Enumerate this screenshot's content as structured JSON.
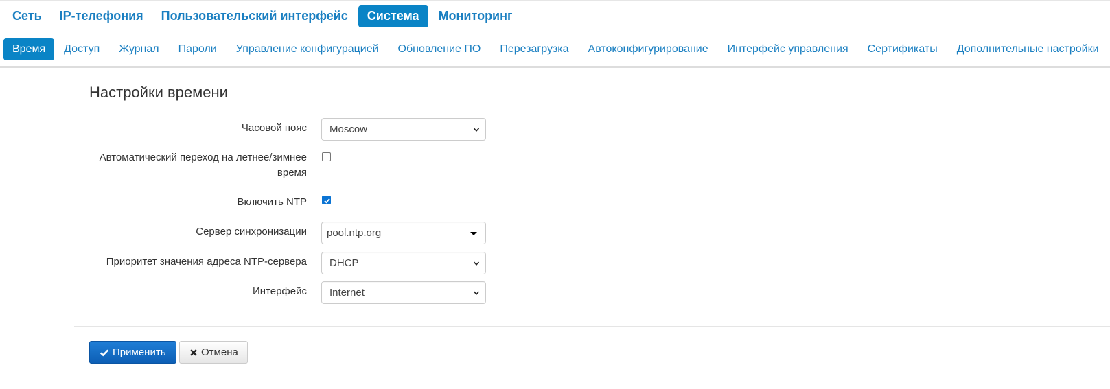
{
  "topnav": {
    "items": [
      {
        "label": "Сеть"
      },
      {
        "label": "IP-телефония"
      },
      {
        "label": "Пользовательский интерфейс"
      },
      {
        "label": "Система"
      },
      {
        "label": "Мониторинг"
      }
    ],
    "active": "Система"
  },
  "subnav": {
    "items": [
      {
        "label": "Время"
      },
      {
        "label": "Доступ"
      },
      {
        "label": "Журнал"
      },
      {
        "label": "Пароли"
      },
      {
        "label": "Управление конфигурацией"
      },
      {
        "label": "Обновление ПО"
      },
      {
        "label": "Перезагрузка"
      },
      {
        "label": "Автоконфигурирование"
      },
      {
        "label": "Интерфейс управления"
      },
      {
        "label": "Сертификаты"
      },
      {
        "label": "Дополнительные настройки"
      }
    ],
    "active": "Время"
  },
  "section": {
    "title": "Настройки времени"
  },
  "form": {
    "timezone": {
      "label": "Часовой пояс",
      "value": "Moscow"
    },
    "dst": {
      "label_line1": "Автоматический переход на летнее/зимнее",
      "label_line2": "время",
      "checked": false
    },
    "ntp": {
      "label": "Включить NTP",
      "checked": true
    },
    "sync_server": {
      "label": "Сервер синхронизации",
      "value": "pool.ntp.org"
    },
    "ntp_priority": {
      "label": "Приоритет значения адреса NTP-сервера",
      "value": "DHCP"
    },
    "interface": {
      "label": "Интерфейс",
      "value": "Internet"
    }
  },
  "buttons": {
    "apply": "Применить",
    "cancel": "Отмена"
  },
  "colors": {
    "accent": "#0a84c6",
    "link": "#1a7fc1",
    "primary_button": "#1a72c9"
  },
  "icons": {
    "apply": "checkmark-icon",
    "cancel": "close-icon",
    "select": "chevron-down-icon",
    "combo": "caret-down-icon"
  }
}
